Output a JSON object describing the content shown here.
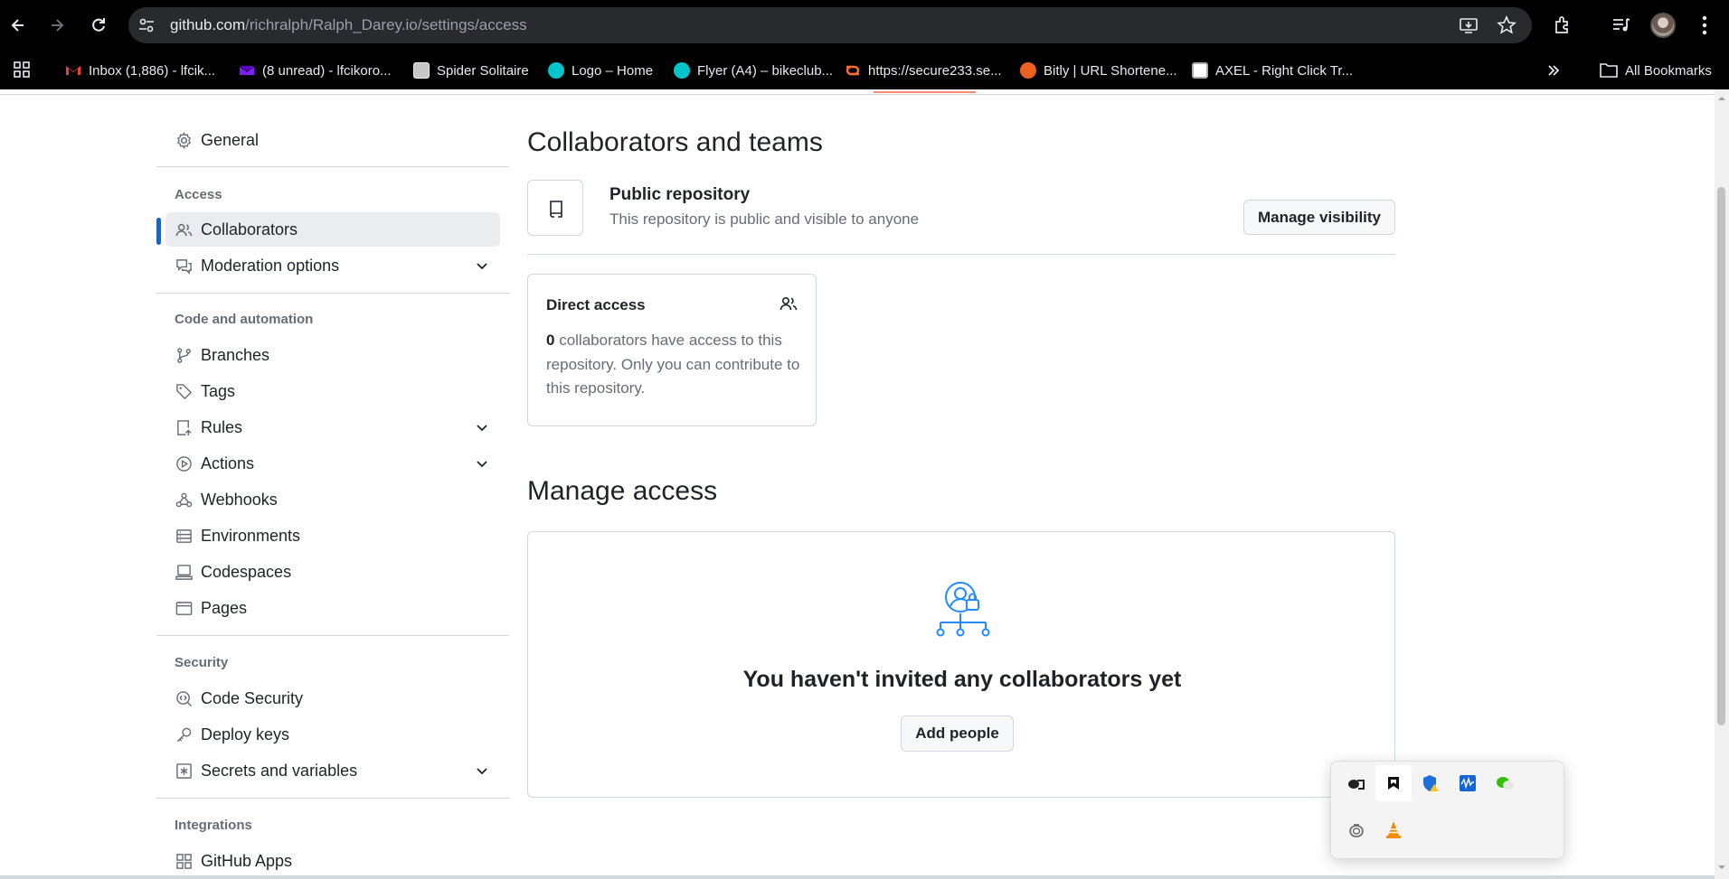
{
  "browser": {
    "url_host": "github.com",
    "url_path": "/richralph/Ralph_Darey.io/settings/access",
    "bookmarks": [
      {
        "label": "Inbox (1,886) - lfcik...",
        "icon": "gmail-icon",
        "color": "#ea4335"
      },
      {
        "label": "(8 unread) - lfcikoro...",
        "icon": "yahoo-mail-icon",
        "color": "#6001d2"
      },
      {
        "label": "Spider Solitaire",
        "icon": "solitaire-icon",
        "color": "#c8c8c8"
      },
      {
        "label": "Logo – Home",
        "icon": "canva-icon",
        "color": "#00c4cc"
      },
      {
        "label": "Flyer (A4) – bikeclub...",
        "icon": "canva-icon",
        "color": "#00c4cc"
      },
      {
        "label": "https://secure233.se...",
        "icon": "cpanel-icon",
        "color": "#ff6c2c"
      },
      {
        "label": "Bitly | URL Shortene...",
        "icon": "bitly-icon",
        "color": "#ee6123"
      },
      {
        "label": "AXEL - Right Click Tr...",
        "icon": "document-icon",
        "color": "#ffffff"
      }
    ],
    "all_bookmarks_label": "All Bookmarks"
  },
  "sidebar": {
    "general": "General",
    "access_heading": "Access",
    "collaborators": "Collaborators",
    "moderation": "Moderation options",
    "code_heading": "Code and automation",
    "branches": "Branches",
    "tags": "Tags",
    "rules": "Rules",
    "actions": "Actions",
    "webhooks": "Webhooks",
    "environments": "Environments",
    "codespaces": "Codespaces",
    "pages": "Pages",
    "security_heading": "Security",
    "code_security": "Code Security",
    "deploy_keys": "Deploy keys",
    "secrets": "Secrets and variables",
    "integrations_heading": "Integrations",
    "github_apps": "GitHub Apps"
  },
  "main": {
    "title": "Collaborators and teams",
    "public_title": "Public repository",
    "public_desc": "This repository is public and visible to anyone",
    "manage_visibility": "Manage visibility",
    "direct_access_title": "Direct access",
    "collab_count": "0",
    "direct_access_desc": " collaborators have access to this repository. Only you can contribute to this repository.",
    "manage_access_title": "Manage access",
    "blank_title": "You haven't invited any collaborators yet",
    "add_people": "Add people"
  },
  "colors": {
    "accent": "#0969da",
    "border": "#d0d7de",
    "muted_text": "#656d76",
    "illustration_blue": "#218bff"
  }
}
